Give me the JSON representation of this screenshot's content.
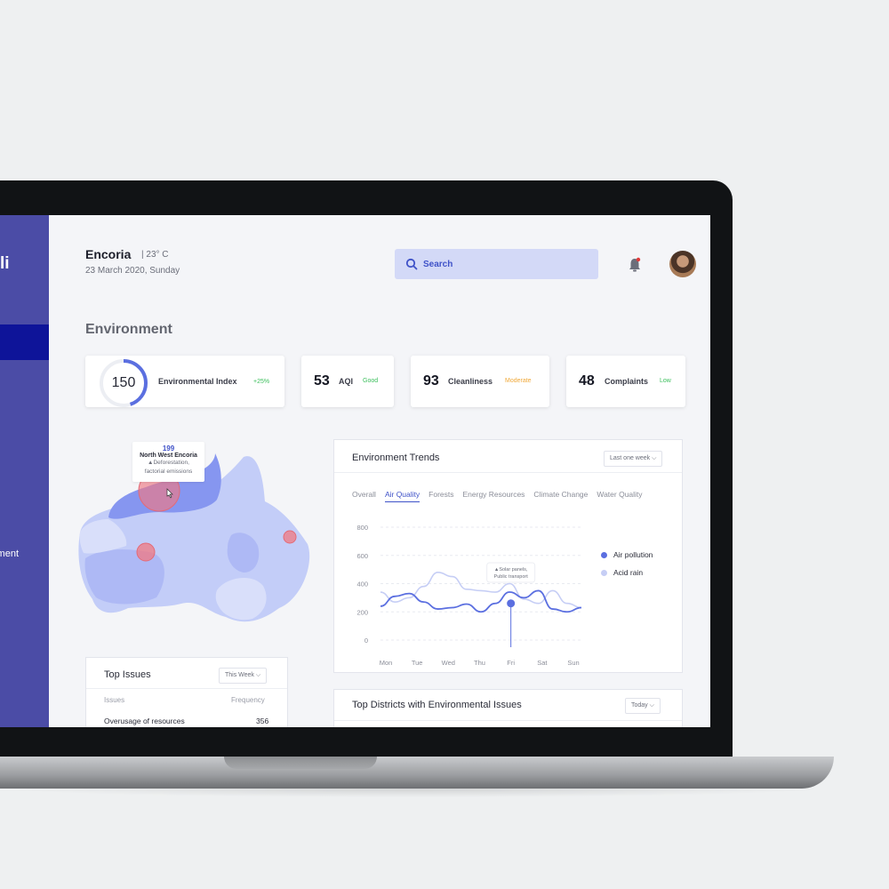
{
  "sidebar": {
    "logo_fragment": "li",
    "item_fragment": "nment"
  },
  "header": {
    "city": "Encoria",
    "temperature": "| 23° C",
    "date": "23 March 2020, Sunday",
    "search_placeholder": "Search"
  },
  "section_title": "Environment",
  "stats": [
    {
      "value": "150",
      "label": "Environmental Index",
      "badge": "+25%",
      "badge_color": "#3bbf5c",
      "ring_fraction": 0.45
    },
    {
      "value": "53",
      "label": "AQI",
      "badge": "Good",
      "badge_color": "#3bbf5c"
    },
    {
      "value": "93",
      "label": "Cleanliness",
      "badge": "Moderate",
      "badge_color": "#f0a93a"
    },
    {
      "value": "48",
      "label": "Complaints",
      "badge": "Low",
      "badge_color": "#3bbf5c"
    }
  ],
  "map": {
    "tooltip_value": "199",
    "tooltip_region": "North West Encoria",
    "tooltip_line1": "▲Deforestation,",
    "tooltip_line2": "factorial emissions"
  },
  "trends": {
    "title": "Environment Trends",
    "range": "Last one week",
    "tabs": [
      "Overall",
      "Air Quality",
      "Forests",
      "Energy Resources",
      "Climate Change",
      "Water Quality"
    ],
    "active_tab": "Air Quality",
    "annotation_line1": "▲Solar panels,",
    "annotation_line2": "Public transport",
    "colors": {
      "primary": "#5b6fe0",
      "secondary": "#c6cef5"
    },
    "chart_data": {
      "type": "line",
      "x": [
        "Mon",
        "Tue",
        "Wed",
        "Thu",
        "Fri",
        "Sat",
        "Sun"
      ],
      "ylim": [
        0,
        800
      ],
      "yticks": [
        0,
        200,
        400,
        600,
        800
      ],
      "series": [
        {
          "name": "Air pollution",
          "values": [
            240,
            310,
            330,
            270,
            220,
            230,
            255,
            200,
            260,
            340,
            300,
            350,
            220,
            200,
            230
          ]
        },
        {
          "name": "Acid rain",
          "values": [
            340,
            270,
            300,
            380,
            480,
            450,
            360,
            350,
            340,
            400,
            290,
            260,
            350,
            260,
            230
          ]
        }
      ]
    }
  },
  "top_issues": {
    "title": "Top Issues",
    "range": "This Week",
    "col_issue": "Issues",
    "col_freq": "Frequency",
    "rows": [
      {
        "issue": "Overusage of resources",
        "freq": "356"
      }
    ]
  },
  "districts": {
    "title": "Top Districts with Environmental Issues",
    "range": "Today"
  }
}
